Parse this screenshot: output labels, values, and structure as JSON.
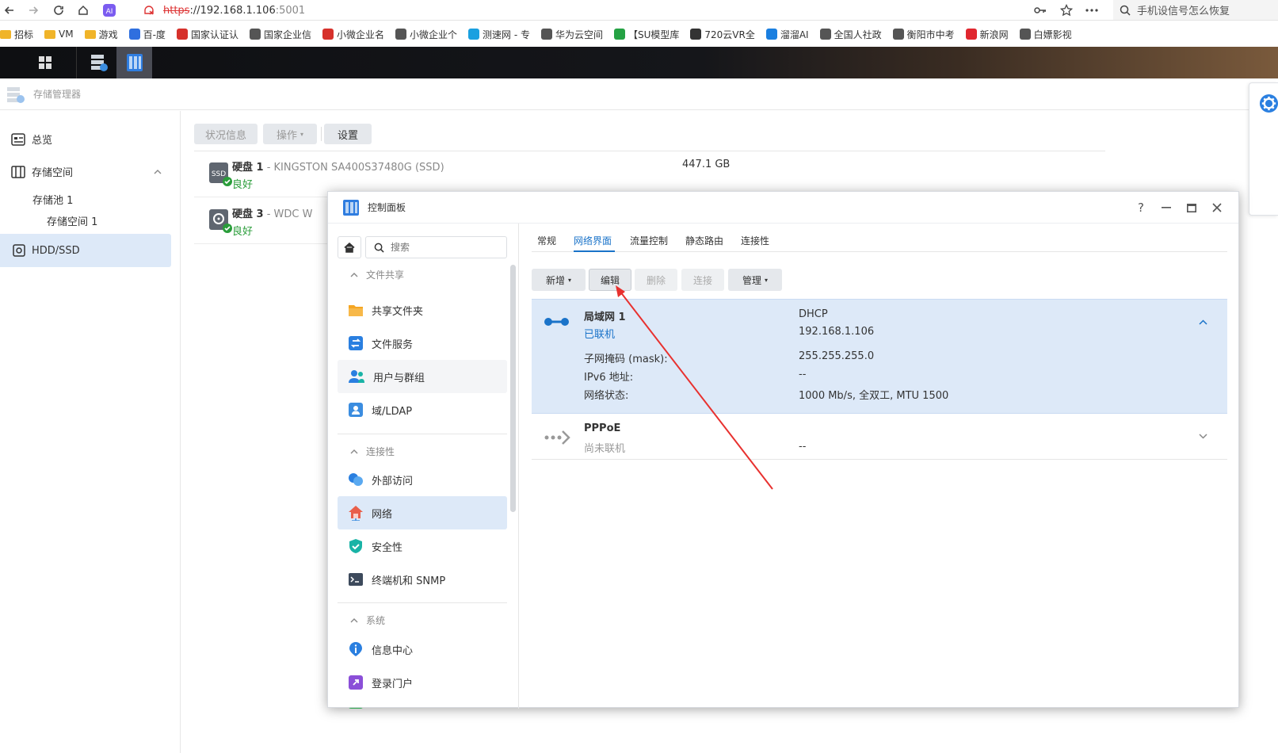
{
  "browser": {
    "url_proto": "https",
    "url_host": "://192.168.1.106",
    "url_port": ":5001",
    "search_text": "手机设信号怎么恢复",
    "bookmarks": [
      {
        "label": "招标",
        "color": "#f0b429"
      },
      {
        "label": "VM",
        "color": "#f0b429"
      },
      {
        "label": "游戏",
        "color": "#f0b429"
      },
      {
        "label": "百-度",
        "color": "#2f6fdf"
      },
      {
        "label": "国家认证认",
        "color": "#d6312b"
      },
      {
        "label": "国家企业信",
        "color": "#555555"
      },
      {
        "label": "小微企业名",
        "color": "#d6312b"
      },
      {
        "label": "小微企业个",
        "color": "#555555"
      },
      {
        "label": "测速网 - 专",
        "color": "#1aa0e0"
      },
      {
        "label": "华为云空间",
        "color": "#555555"
      },
      {
        "label": "【SU模型库",
        "color": "#25a244"
      },
      {
        "label": "720云VR全",
        "color": "#333333"
      },
      {
        "label": "溜溜AI",
        "color": "#1a7fe0"
      },
      {
        "label": "全国人社政",
        "color": "#555555"
      },
      {
        "label": "衡阳市中考",
        "color": "#555555"
      },
      {
        "label": "新浪网",
        "color": "#e0272f"
      },
      {
        "label": "白嫖影视",
        "color": "#555555"
      }
    ]
  },
  "storage_manager": {
    "title": "存储管理器",
    "sidebar": {
      "overview": "总览",
      "storage_space": "存储空间",
      "pool": "存储池 1",
      "volume": "存储空间 1",
      "hdd_ssd": "HDD/SSD"
    },
    "toolbar": {
      "status_info": "状况信息",
      "operations": "操作",
      "settings": "设置"
    },
    "disks": [
      {
        "name": "硬盘 1",
        "model": " - KINGSTON SA400S37480G (SSD)",
        "status": "良好",
        "size": "447.1 GB",
        "badge": "SSD"
      },
      {
        "name": "硬盘 3",
        "model": " - WDC W",
        "status": "良好",
        "size": "",
        "badge": ""
      }
    ]
  },
  "control_panel": {
    "title": "控制面板",
    "search_placeholder": "搜索",
    "sections": {
      "file_sharing": "文件共享",
      "connectivity": "连接性",
      "system": "系统"
    },
    "nav_items": {
      "shared_folder": "共享文件夹",
      "file_services": "文件服务",
      "users_groups": "用户与群组",
      "domain_ldap": "域/LDAP",
      "external_access": "外部访问",
      "network": "网络",
      "security": "安全性",
      "terminal_snmp": "终端机和 SNMP",
      "info_center": "信息中心",
      "login_portal": "登录门户"
    },
    "tabs": {
      "general": "常规",
      "network_interface": "网络界面",
      "traffic_control": "流量控制",
      "static_route": "静态路由",
      "connectivity": "连接性"
    },
    "actions": {
      "create": "新增",
      "edit": "编辑",
      "delete": "删除",
      "connect": "连接",
      "manage": "管理"
    },
    "interfaces": {
      "lan": {
        "name": "局域网 1",
        "status": "已联机",
        "mode": "DHCP",
        "ip": "192.168.1.106",
        "subnet_label": "子网掩码 (mask):",
        "subnet_value": "255.255.255.0",
        "ipv6_label": "IPv6 地址:",
        "ipv6_value": "--",
        "net_status_label": "网络状态:",
        "net_status_value": "1000 Mb/s, 全双工, MTU 1500"
      },
      "pppoe": {
        "name": "PPPoE",
        "status": "尚未联机",
        "value": "--"
      }
    }
  },
  "colors": {
    "accent": "#1a73c9",
    "selected_bg": "#dde9f8",
    "ok_green": "#2a9d3a",
    "annotation_arrow": "#e8312f"
  }
}
